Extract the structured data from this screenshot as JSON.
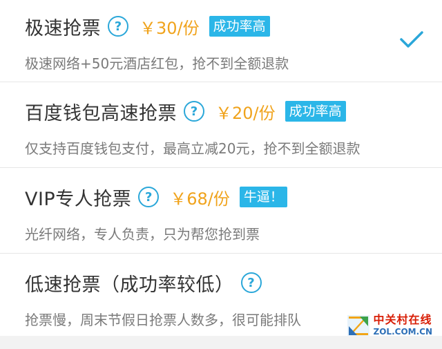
{
  "options": [
    {
      "title": "极速抢票",
      "help_icon": "question-circle-icon",
      "help_glyph": "?",
      "price": "￥30/份",
      "badge": "成功率高",
      "description": "极速网络+50元酒店红包，抢不到全额退款",
      "selected": true
    },
    {
      "title": "百度钱包高速抢票",
      "help_icon": "question-circle-icon",
      "help_glyph": "?",
      "price": "￥20/份",
      "badge": "成功率高",
      "description": "仅支持百度钱包支付，最高立减20元，抢不到全额退款",
      "selected": false
    },
    {
      "title": "VIP专人抢票",
      "help_icon": "question-circle-icon",
      "help_glyph": "?",
      "price": "￥68/份",
      "badge": "牛逼！",
      "description": "光纤网络，专人负责，只为帮您抢到票",
      "selected": false
    },
    {
      "title": "低速抢票（成功率较低）",
      "help_icon": "question-circle-icon",
      "help_glyph": "?",
      "price": "",
      "badge": "",
      "description": "抢票慢，周末节假日抢票人数多，很可能排队",
      "selected": false
    }
  ],
  "selection_icon": "checkmark-icon",
  "watermark": {
    "cn": "中关村在线",
    "en": "ZOL.COM.CN",
    "logo_icon": "zol-logo-icon"
  },
  "colors": {
    "accent": "#2aa7d9",
    "badge": "#2bb6e8",
    "price": "#f0a31c",
    "title": "#333333",
    "description": "#7a7a7a"
  }
}
